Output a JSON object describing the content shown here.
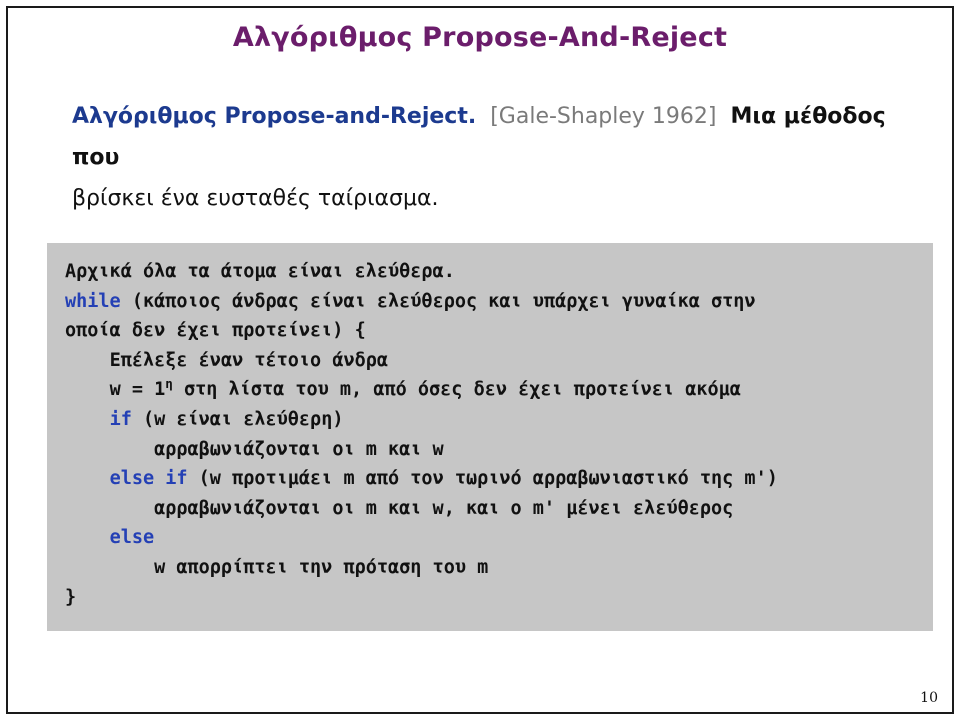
{
  "slide": {
    "title": "Αλγόριθμος Propose-And-Reject",
    "page_number": "10",
    "title_color": "#6b1d6b",
    "keyword_color": "#2440b5",
    "lead_name_color": "#1c3a8f",
    "citation_color": "#7a7a7a",
    "code_background_color": "#c6c6c6"
  },
  "lead": {
    "name": "Αλγόριθμος Propose-and-Reject.",
    "citation": "[Gale-Shapley 1962]",
    "description_part1": "Μια μέθοδος που",
    "description_part2": "βρίσκει ένα ευσταθές ταίριασμα."
  },
  "code": {
    "lines": [
      {
        "indent": 0,
        "keyword": "",
        "text": "Αρχικά όλα τα άτομα είναι ελεύθερα.",
        "superscript": ""
      },
      {
        "indent": 0,
        "keyword": "while",
        "text": " (κάποιος άνδρας είναι ελεύθερος και υπάρχει γυναίκα στην",
        "superscript": ""
      },
      {
        "indent": 0,
        "keyword": "",
        "text": "οποία δεν έχει προτείνει) {",
        "superscript": ""
      },
      {
        "indent": 1,
        "keyword": "",
        "text": "Επέλεξε έναν τέτοιο άνδρα",
        "superscript": ""
      },
      {
        "indent": 1,
        "keyword": "",
        "text_before_sup": "w = 1",
        "superscript": "η",
        "text": " στη λίστα του m, από όσες δεν έχει προτείνει ακόμα"
      },
      {
        "indent": 1,
        "keyword": "if",
        "text": " (w είναι ελεύθερη)",
        "superscript": ""
      },
      {
        "indent": 2,
        "keyword": "",
        "text": "αρραβωνιάζονται οι m και w",
        "superscript": ""
      },
      {
        "indent": 1,
        "keyword": "else if",
        "text": " (w προτιμάει m από τον τωρινό αρραβωνιαστικό της m')",
        "superscript": ""
      },
      {
        "indent": 2,
        "keyword": "",
        "text": "αρραβωνιάζονται οι m και w, και ο m' μένει ελεύθερος",
        "superscript": ""
      },
      {
        "indent": 1,
        "keyword": "else",
        "text": "",
        "superscript": ""
      },
      {
        "indent": 2,
        "keyword": "",
        "text": "w απορρίπτει την πρόταση του m",
        "superscript": ""
      },
      {
        "indent": -1,
        "keyword": "",
        "text": "}",
        "superscript": ""
      }
    ]
  }
}
